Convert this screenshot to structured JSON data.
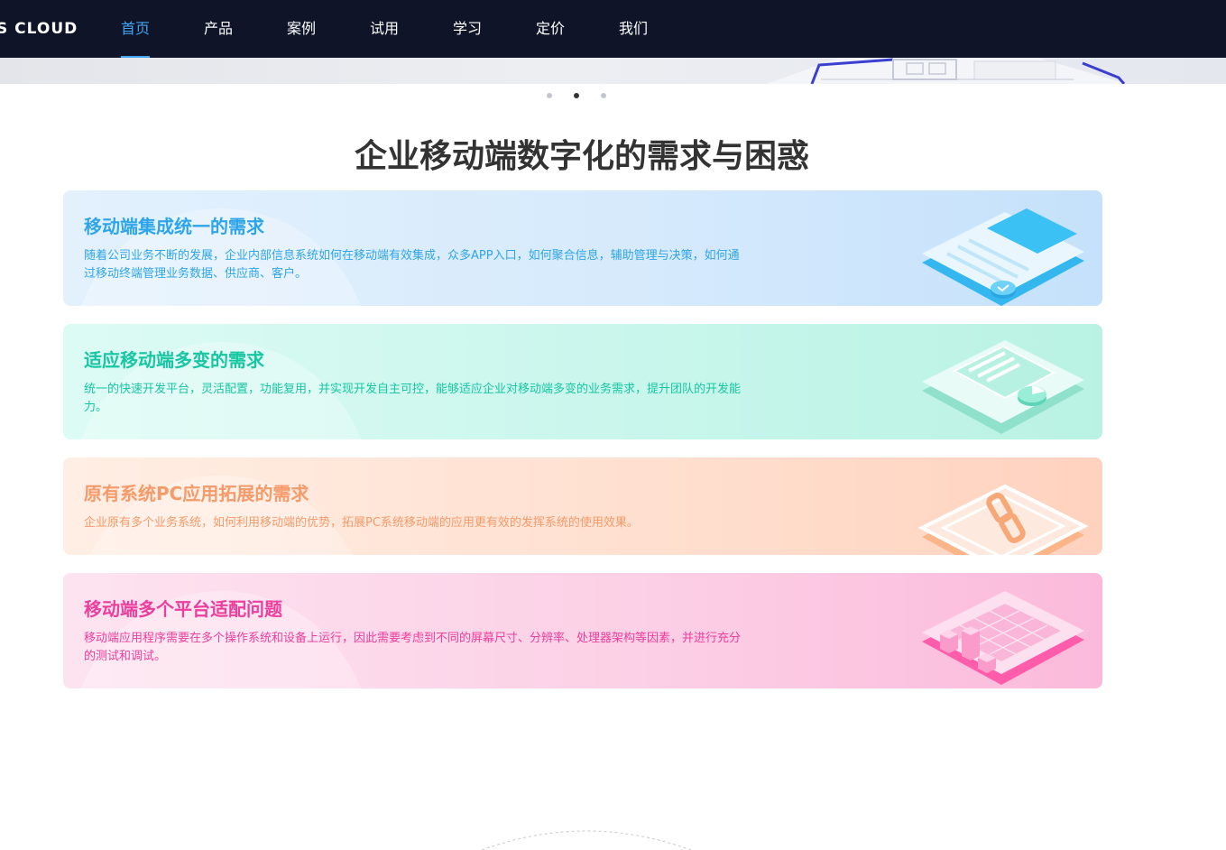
{
  "header": {
    "logo": "S CLOUD",
    "nav": [
      {
        "label": "首页",
        "active": true
      },
      {
        "label": "产品",
        "active": false
      },
      {
        "label": "案例",
        "active": false
      },
      {
        "label": "试用",
        "active": false
      },
      {
        "label": "学习",
        "active": false
      },
      {
        "label": "定价",
        "active": false
      },
      {
        "label": "我们",
        "active": false
      }
    ]
  },
  "carousel": {
    "slide_count": 3,
    "active_index": 1
  },
  "section": {
    "title": "企业移动端数字化的需求与困惑",
    "cards": [
      {
        "title": "移动端集成统一的需求",
        "desc": "随着公司业务不断的发展，企业内部信息系统如何在移动端有效集成，众多APP入口，如何聚合信息，辅助管理与决策，如何通过移动终端管理业务数据、供应商、客户。",
        "icon": "document-chart-icon",
        "color": "#2ea5e8"
      },
      {
        "title": "适应移动端多变的需求",
        "desc": "统一的快速开发平台，灵活配置，功能复用，并实现开发自主可控，能够适应企业对移动端多变的业务需求，提升团队的开发能力。",
        "icon": "dashboard-window-icon",
        "color": "#17c6a2"
      },
      {
        "title": "原有系统PC应用拓展的需求",
        "desc": "企业原有多个业务系统，如何利用移动端的优势，拓展PC系统移动端的应用更有效的发挥系统的使用效果。",
        "icon": "chain-link-icon",
        "color": "#f59a69"
      },
      {
        "title": "移动端多个平台适配问题",
        "desc": "移动端应用程序需要在多个操作系统和设备上运行，因此需要考虑到不同的屏幕尺寸、分辨率、处理器架构等因素，并进行充分的测试和调试。",
        "icon": "grid-blocks-icon",
        "color": "#ec3e9c"
      }
    ]
  }
}
